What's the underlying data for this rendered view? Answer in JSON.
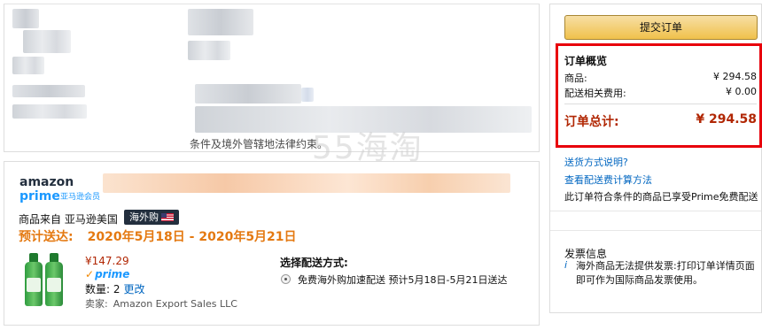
{
  "address_section": {
    "cut_text": "条件及境外管辖地法律约束。"
  },
  "watermark": "55海淘",
  "shipment": {
    "logo_word": "amazon",
    "logo_prime": "prime",
    "logo_sub": "亚马逊会员",
    "sold_from": "商品来自 亚马逊美国",
    "badge_label": "海外购",
    "eta_label": "预计送达:",
    "eta_range": "2020年5月18日 - 2020年5月21日",
    "item": {
      "price": "¥147.29",
      "prime_label": "prime",
      "qty_label": "数量:",
      "qty_value": "2",
      "change_label": "更改",
      "seller_label": "卖家:",
      "seller_name": "Amazon Export Sales LLC"
    },
    "ship_option_title": "选择配送方式:",
    "ship_option": "免费海外购加速配送 预计5月18日-5月21日送达"
  },
  "sidebar": {
    "place_order": "提交订单",
    "summary": {
      "title": "订单概览",
      "items_label": "商品:",
      "items_value": "¥ 294.58",
      "shipping_label": "配送相关费用:",
      "shipping_value": "¥ 0.00",
      "total_label": "订单总计:",
      "total_value": "¥ 294.58"
    },
    "links": {
      "shipping_method": "送货方式说明?",
      "shipping_fee": "查看配送费计算方法"
    },
    "prime_note": "此订单符合条件的商品已享受Prime免费配送",
    "invoice": {
      "title": "发票信息",
      "text": "海外商品无法提供发票:打印订单详情页面即可作为国际商品发票使用。"
    }
  },
  "colors": {
    "accent_orange": "#e47911",
    "price_red": "#b12704",
    "link_blue": "#0066c0",
    "highlight_red": "#e8000b",
    "button_yellow": "#f0c14b"
  }
}
